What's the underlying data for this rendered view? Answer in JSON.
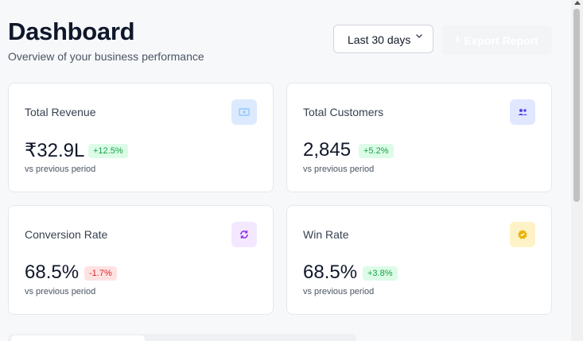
{
  "header": {
    "title": "Dashboard",
    "subtitle": "Overview of your business performance",
    "period_select": "Last 30 days",
    "export_label": "Export Report"
  },
  "metrics": [
    {
      "title": "Total Revenue",
      "value": "₹32.9L",
      "change": "+12.5%",
      "trend": "up",
      "subtext": "vs previous period",
      "icon": "money-icon",
      "icon_bg": "#dbeafe",
      "icon_color": "#93c5fd"
    },
    {
      "title": "Total Customers",
      "value": "2,845",
      "change": "+5.2%",
      "trend": "up",
      "subtext": "vs previous period",
      "icon": "users-icon",
      "icon_bg": "#e0e7ff",
      "icon_color": "#4f46e5"
    },
    {
      "title": "Conversion Rate",
      "value": "68.5%",
      "change": "-1.7%",
      "trend": "down",
      "subtext": "vs previous period",
      "icon": "refresh-icon",
      "icon_bg": "#f3e8ff",
      "icon_color": "#9333ea"
    },
    {
      "title": "Win Rate",
      "value": "68.5%",
      "change": "+3.8%",
      "trend": "up",
      "subtext": "vs previous period",
      "icon": "badge-icon",
      "icon_bg": "#fef3c7",
      "icon_color": "#eab308"
    }
  ],
  "colors": {
    "accent_up": "#16a34a",
    "accent_down": "#dc2626"
  }
}
